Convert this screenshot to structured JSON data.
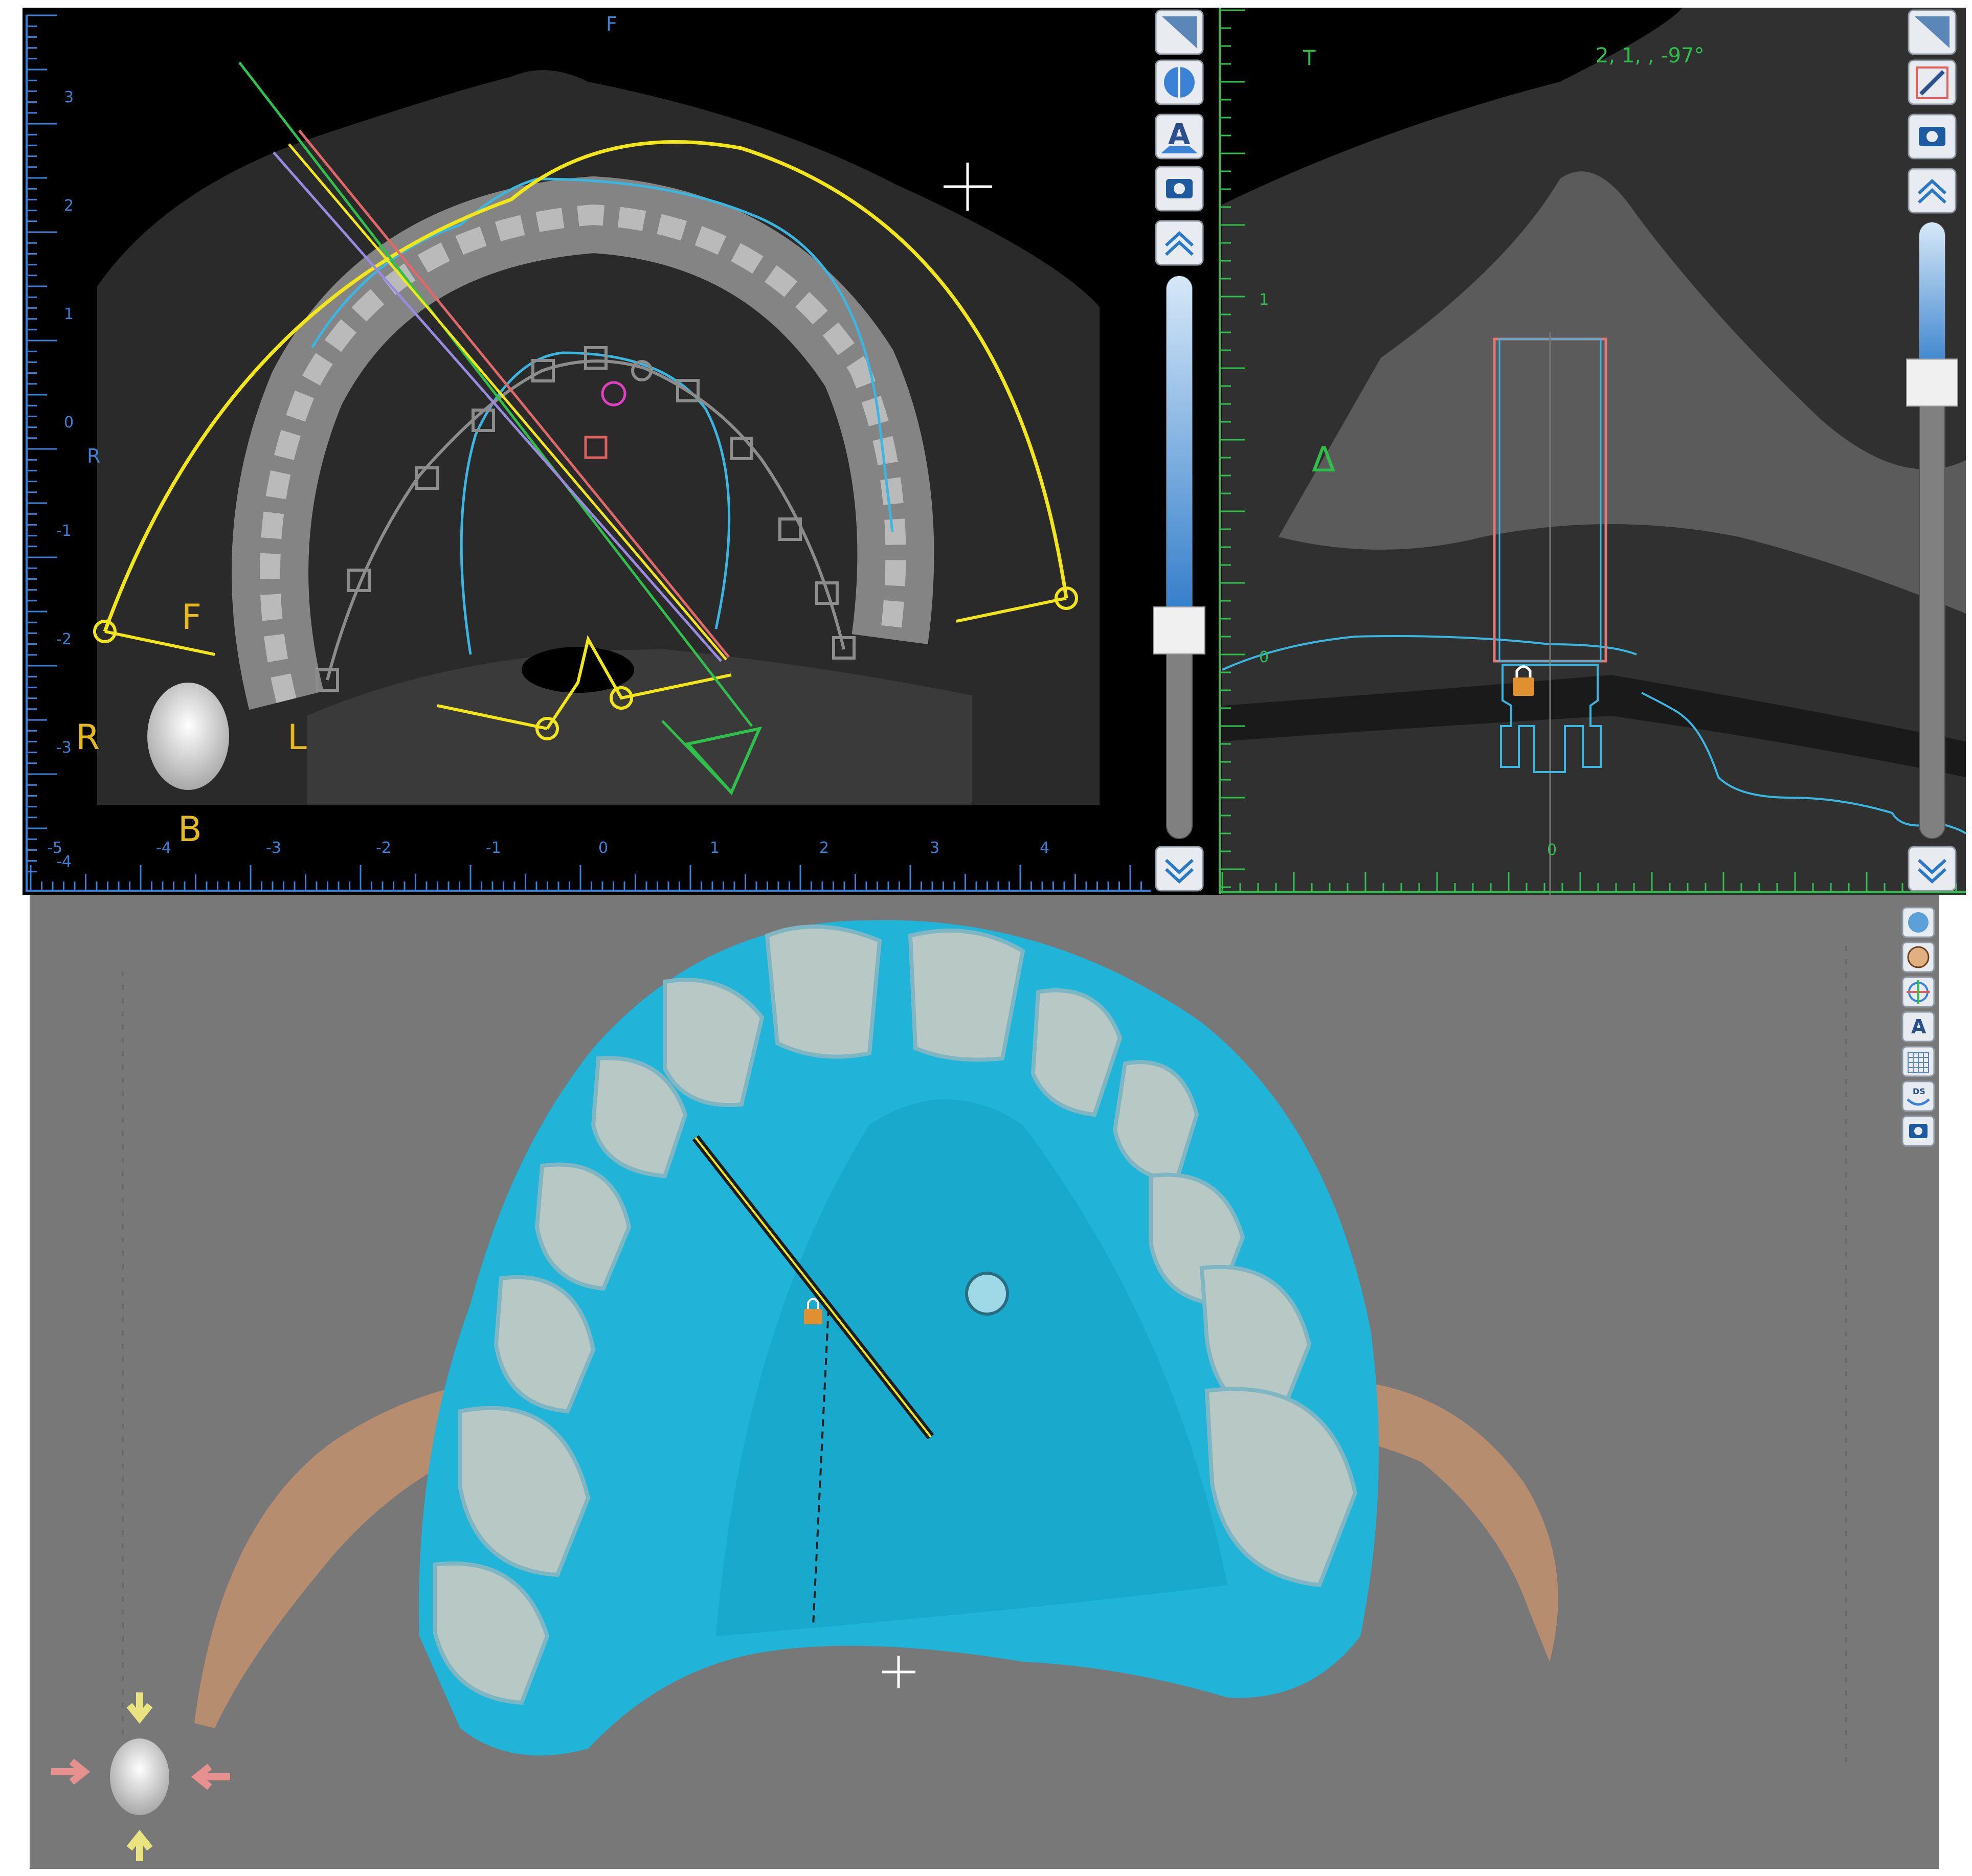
{
  "axial_view": {
    "orientation": {
      "top": "F",
      "left": "R"
    },
    "ruler_x_ticks": [
      "-5",
      "-4",
      "-3",
      "-2",
      "-1",
      "0",
      "1",
      "2",
      "3",
      "4"
    ],
    "ruler_y_ticks": [
      "3",
      "2",
      "1",
      "0",
      "-1",
      "-2",
      "-3",
      "-4"
    ],
    "cube_labels": {
      "front": "F",
      "right": "R",
      "left": "L",
      "bottom": "B"
    },
    "toolbar": [
      "measure-icon",
      "contrast-icon",
      "annotation-icon",
      "snapshot-icon",
      "scroll-up-icon",
      "scroll-down-icon"
    ],
    "slider_level": 0.63
  },
  "cross_view": {
    "orientation_top": "T",
    "readout": "2, 1, , -97°",
    "delta_marker": "Δ",
    "ruler_y_ticks": [
      "1",
      "0"
    ],
    "ruler_x_ticks": [
      "0"
    ],
    "toolbar": [
      "measure-icon",
      "pen-icon",
      "snapshot-icon",
      "scroll-up-icon",
      "scroll-down-icon"
    ],
    "slider_level": 0.26
  },
  "view_3d": {
    "side_toolbar": [
      "skull-icon",
      "face-icon",
      "orientation-icon",
      "annotation-icon",
      "grid-icon",
      "ds-icon",
      "snapshot-icon"
    ],
    "ds_label": "DS",
    "colors": {
      "background": "#787878",
      "scan": "#1fb4d8",
      "bone": "#b78d6f",
      "teeth": "#b8c8c4"
    }
  },
  "colors": {
    "ruler_axial": "#3b82d6",
    "ruler_cross": "#2fbf4a",
    "curve_yellow": "#f2e51a",
    "nerve_cyan": "#3ab6e0",
    "arch_gray": "#8c8c8c"
  }
}
